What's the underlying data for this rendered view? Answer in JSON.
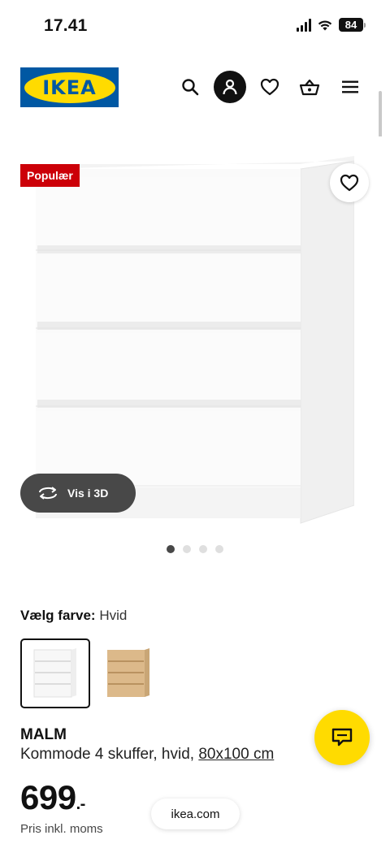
{
  "status_bar": {
    "time": "17.41",
    "battery": "84"
  },
  "header": {
    "logo_text": "IKEA",
    "icons": [
      "search-icon",
      "profile-icon",
      "heart-icon",
      "basket-icon",
      "menu-icon"
    ]
  },
  "product_image": {
    "badge": "Populær",
    "view_3d_label": "Vis i 3D",
    "carousel": {
      "total": 4,
      "active": 1
    }
  },
  "color_select": {
    "label": "Vælg farve:",
    "value": "Hvid",
    "options": [
      "Hvid",
      "Egetræsfinér"
    ]
  },
  "product": {
    "name": "MALM",
    "description": "Kommode 4 skuffer, hvid,",
    "size": "80x100 cm",
    "price": "699",
    "price_suffix": ".-",
    "price_note": "Pris inkl. moms"
  },
  "browser": {
    "url": "ikea.com"
  },
  "colors": {
    "ikea_blue": "#0058a3",
    "ikea_yellow": "#ffdb00",
    "badge_red": "#cc0008"
  }
}
